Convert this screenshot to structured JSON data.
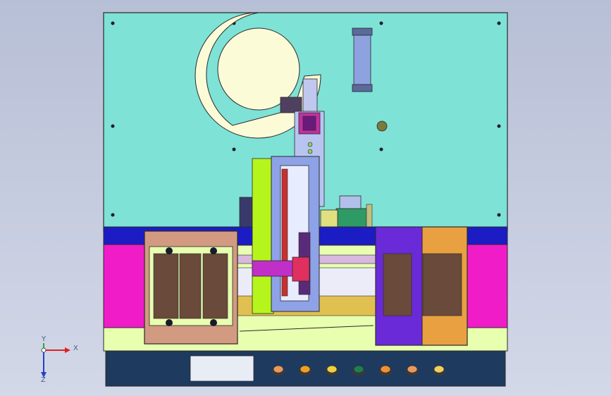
{
  "viewport": {
    "background_top": "#b7bfd6",
    "background_bottom": "#d3d8e8"
  },
  "machine": {
    "frame_color": "#7fe2d6",
    "rail_blue_color": "#1c1cc4",
    "magenta_color": "#f01cc8",
    "base_green_color": "#e8ffb0",
    "control_panel_color": "#1e3a5e",
    "disc_color": "#fbfbd8",
    "tray_brown_color": "#d29a80",
    "tray_purple_color": "#6a2ad8",
    "gantry_color": "#8ea2e8",
    "lime_color": "#b5f51c",
    "display_text": "",
    "buttons": [
      {
        "name": "button-1",
        "color": "#e79a5a"
      },
      {
        "name": "button-2",
        "color": "#f0a020"
      },
      {
        "name": "button-3",
        "color": "#f0d040"
      },
      {
        "name": "button-4",
        "color": "#1e8050"
      },
      {
        "name": "button-5",
        "color": "#f09030"
      },
      {
        "name": "button-6",
        "color": "#e89860"
      },
      {
        "name": "button-7",
        "color": "#f0d060"
      }
    ]
  },
  "axis_triad": {
    "x_label": "X",
    "y_label": "Y",
    "z_label": "Z",
    "x_color": "#e02020",
    "y_color": "#20b020",
    "z_color": "#2040d0"
  }
}
